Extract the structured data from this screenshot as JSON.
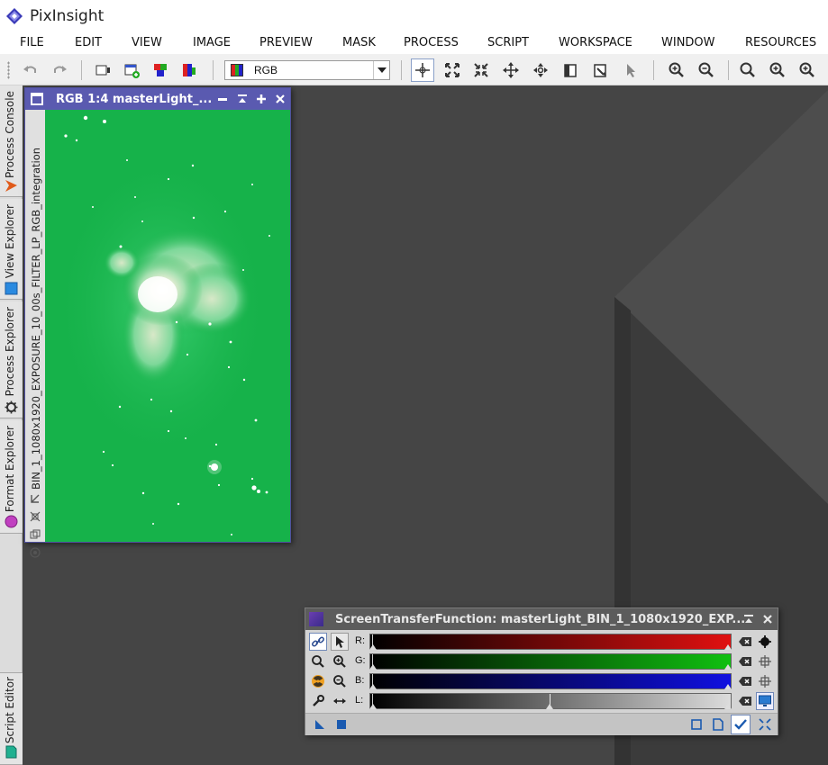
{
  "app": {
    "title": "PixInsight"
  },
  "menu": [
    "FILE",
    "EDIT",
    "VIEW",
    "IMAGE",
    "PREVIEW",
    "MASK",
    "PROCESS",
    "SCRIPT",
    "WORKSPACE",
    "WINDOW",
    "RESOURCES"
  ],
  "toolbar": {
    "channel_select": "RGB"
  },
  "sidebar": {
    "tabs": [
      "Process Console",
      "View Explorer",
      "Process Explorer",
      "Format Explorer",
      "Script Editor"
    ]
  },
  "image_window": {
    "title": "RGB 1:4 masterLight_...",
    "view_id": "BIN_1_1080x1920_EXPOSURE_10_00s_FILTER_LP_RGB_integration"
  },
  "stf": {
    "title": "ScreenTransferFunction: masterLight_BIN_1_1080x1920_EXP...",
    "channels": [
      {
        "label": "R:",
        "color": "#e01010"
      },
      {
        "label": "G:",
        "color": "#10c010"
      },
      {
        "label": "B:",
        "color": "#1010e0"
      },
      {
        "label": "L:",
        "color": "#dcdcdc"
      }
    ]
  },
  "colors": {
    "workspace": "#454545",
    "image_window_accent": "#5a5ab0",
    "image_background": "#16b24a"
  }
}
